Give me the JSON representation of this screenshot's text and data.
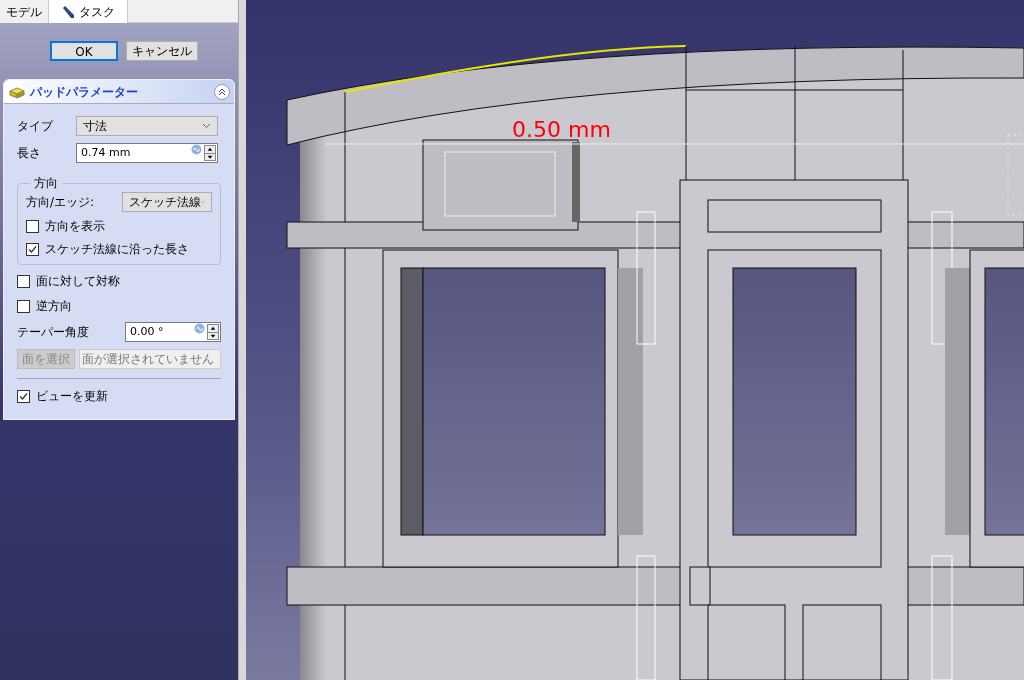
{
  "tabs": [
    {
      "label": "モデル",
      "selected": false
    },
    {
      "label": "タスク",
      "selected": true
    }
  ],
  "dialog_buttons": [
    {
      "label": "OK",
      "focused": true
    },
    {
      "label": "キャンセル",
      "focused": false
    }
  ],
  "panel": {
    "title": "パッドパラメーター",
    "expanded": true,
    "type": {
      "label": "タイプ",
      "value": "寸法"
    },
    "length": {
      "label": "長さ",
      "value": "0.74 mm"
    },
    "direction": {
      "title": "方向",
      "edge_label": "方向/エッジ:",
      "edge_value": "スケッチ法線",
      "checkboxes": [
        {
          "label": "方向を表示",
          "checked": false
        },
        {
          "label": "スケッチ法線に沿った長さ",
          "checked": true
        }
      ]
    },
    "options": [
      {
        "label": "面に対して対称",
        "checked": false
      },
      {
        "label": "逆方向",
        "checked": false
      }
    ],
    "taper": {
      "label": "テーパー角度",
      "value": "0.00 °"
    },
    "face": {
      "button": "面を選択",
      "disabled": true,
      "placeholder": "面が選択されていません"
    },
    "refresh": {
      "label": "ビューを更新",
      "checked": true
    }
  },
  "viewport": {
    "dimension_label": "0.50 mm"
  }
}
